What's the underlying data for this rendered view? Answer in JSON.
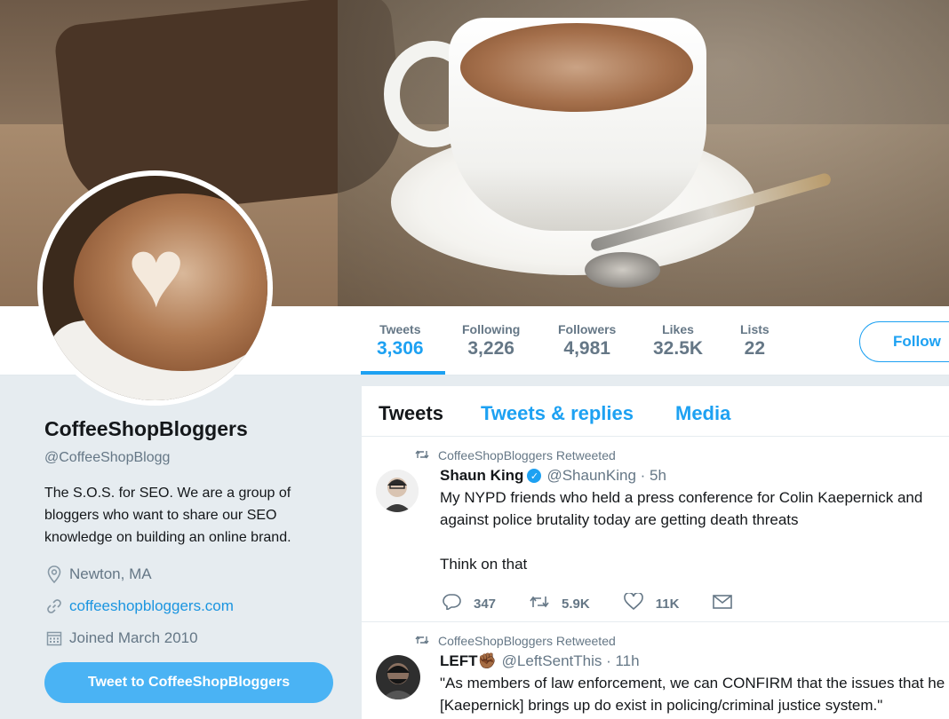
{
  "profile": {
    "name": "CoffeeShopBloggers",
    "handle": "@CoffeeShopBlogg",
    "bio": "The S.O.S. for SEO. We are a group of bloggers who want to share our SEO knowledge on building an online brand.",
    "location": "Newton, MA",
    "website": "coffeeshopbloggers.com",
    "joined": "Joined March 2010",
    "tweet_to_label": "Tweet to CoffeeShopBloggers"
  },
  "stats": [
    {
      "label": "Tweets",
      "value": "3,306"
    },
    {
      "label": "Following",
      "value": "3,226"
    },
    {
      "label": "Followers",
      "value": "4,981"
    },
    {
      "label": "Likes",
      "value": "32.5K"
    },
    {
      "label": "Lists",
      "value": "22"
    }
  ],
  "follow_label": "Follow",
  "tabs": [
    "Tweets",
    "Tweets & replies",
    "Media"
  ],
  "tweets": [
    {
      "retweeted_by": "CoffeeShopBloggers Retweeted",
      "name": "Shaun King",
      "verified": true,
      "handle": "@ShaunKing · 5h",
      "text": "My NYPD friends who held a press conference for Colin Kaepernick and against police brutality today are getting death threats\n\nThink on that",
      "replies": "347",
      "retweets": "5.9K",
      "likes": "11K"
    },
    {
      "retweeted_by": "CoffeeShopBloggers Retweeted",
      "name": "LEFT✊🏾",
      "handle": "@LeftSentThis · 11h",
      "text": "\"As members of law enforcement, we can CONFIRM that the issues that he [Kaepernick] brings up do exist in policing/criminal justice system.\""
    }
  ],
  "colors": {
    "accent": "#1da1f2",
    "text": "#14171a",
    "muted": "#657786",
    "background": "#e6ecf0"
  },
  "icons": [
    "location-icon",
    "link-icon",
    "calendar-icon",
    "retweet-icon",
    "reply-icon",
    "like-icon",
    "message-icon",
    "verified-icon"
  ]
}
